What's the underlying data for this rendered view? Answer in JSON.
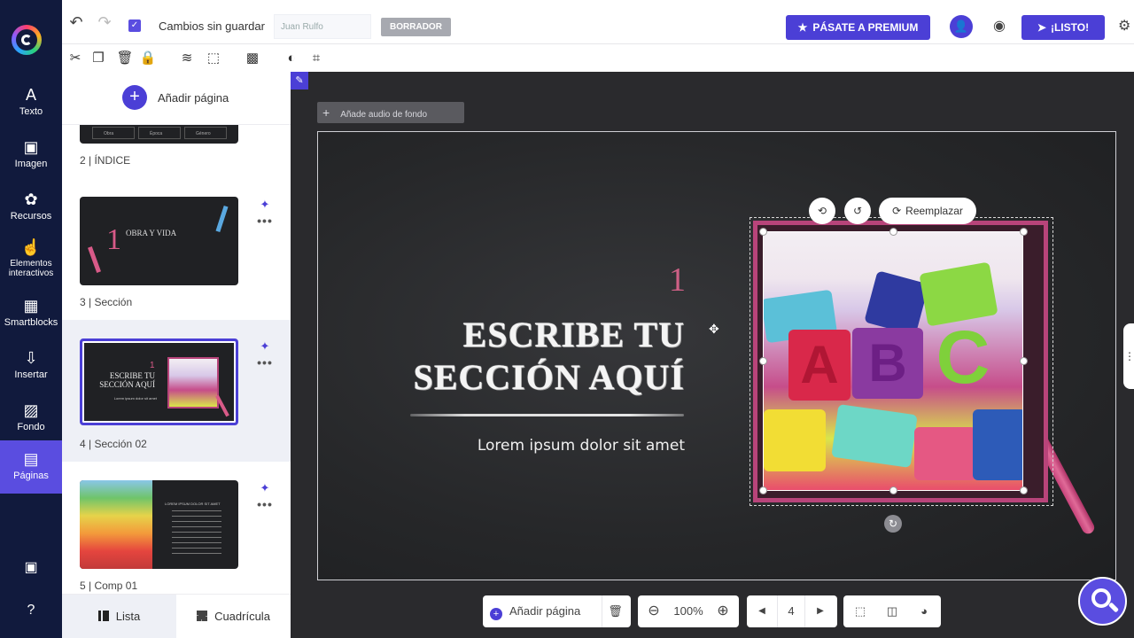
{
  "rail": {
    "items": [
      {
        "icon": "A",
        "label": "Texto"
      },
      {
        "icon": "▣",
        "label": "Imagen"
      },
      {
        "icon": "✿",
        "label": "Recursos"
      },
      {
        "icon": "☝",
        "label": "Elementos interactivos"
      },
      {
        "icon": "▦",
        "label": "Smartblocks"
      },
      {
        "icon": "⇩",
        "label": "Insertar"
      },
      {
        "icon": "▨",
        "label": "Fondo"
      },
      {
        "icon": "▤",
        "label": "Páginas"
      }
    ],
    "active_index": 7
  },
  "header": {
    "undo": "↶",
    "redo": "↷",
    "unsaved": "Cambios sin guardar",
    "author": "Juan Rulfo",
    "draft": "BORRADOR",
    "premium": "PÁSATE A PREMIUM",
    "premium_icon": "★",
    "listo": "¡LISTO!",
    "listo_icon": "➤"
  },
  "toolbar": {
    "icons": [
      "✂",
      "❐",
      "🗑",
      "🔒",
      "≋",
      "⬚",
      "▩",
      "◐",
      "⌗"
    ]
  },
  "pages_panel": {
    "add_page": "Añadir página",
    "pages": [
      {
        "label": "2 |  ÍNDICE",
        "thumb_text": [
          "Obra",
          "Época",
          "Género"
        ]
      },
      {
        "label": "3 |  Sección",
        "thumb_num": "1",
        "thumb_text": "OBRA Y VIDA"
      },
      {
        "label": "4 |  Sección 02",
        "thumb_num": "1",
        "thumb_text": "ESCRIBE TU SECCIÓN AQUÍ",
        "thumb_sub": "Lorem ipsum dolor sit amet"
      },
      {
        "label": "5 |  Comp 01",
        "thumb_text": "LOREM IPSUM DOLOR SIT AMET"
      }
    ],
    "tabs": {
      "list": "Lista",
      "grid": "Cuadrícula"
    }
  },
  "canvas": {
    "audio": "Añade audio de fondo",
    "slide": {
      "section_number": "1",
      "title_line1": "ESCRIBE TU",
      "title_line2": "SECCIÓN AQUÍ",
      "subtitle": "Lorem ipsum dolor sit amet"
    },
    "image_tools": {
      "replace": "Reemplazar"
    },
    "photo_blocks": [
      "A",
      "B",
      "C"
    ]
  },
  "bottom": {
    "add_page": "Añadir página",
    "zoom": "100%",
    "page": "4"
  }
}
